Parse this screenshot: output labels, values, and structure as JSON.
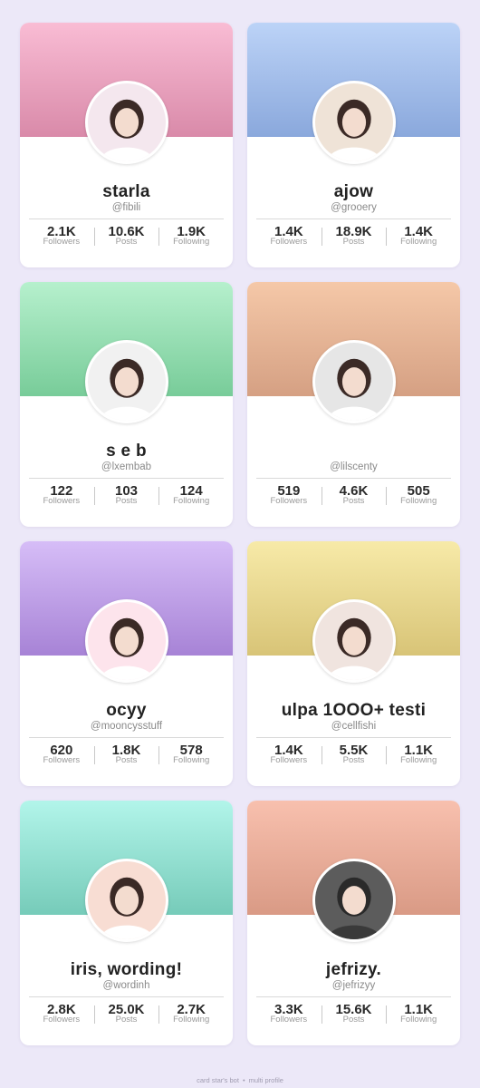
{
  "profiles": [
    {
      "name": "starla",
      "handle": "@fibili",
      "followers": "2.1K",
      "posts": "10.6K",
      "following": "1.9K",
      "banner_top": "#f9bcd4",
      "banner_bottom": "#d98aa9",
      "avatar_bg": "#f4e7ee"
    },
    {
      "name": "ajow",
      "handle": "@grooery",
      "followers": "1.4K",
      "posts": "18.9K",
      "following": "1.4K",
      "banner_top": "#bcd3f7",
      "banner_bottom": "#8aa8dc",
      "avatar_bg": "#efe3d7"
    },
    {
      "name": "s e b",
      "handle": "@lxembab",
      "followers": "122",
      "posts": "103",
      "following": "124",
      "banner_top": "#b6f0cd",
      "banner_bottom": "#78cc99",
      "avatar_bg": "#f1f1f1"
    },
    {
      "name": "",
      "handle": "@lilscenty",
      "followers": "519",
      "posts": "4.6K",
      "following": "505",
      "banner_top": "#f5c8a8",
      "banner_bottom": "#d5a083",
      "avatar_bg": "#e6e6e6"
    },
    {
      "name": "ocyy",
      "handle": "@mooncysstuff",
      "followers": "620",
      "posts": "1.8K",
      "following": "578",
      "banner_top": "#d6bdf7",
      "banner_bottom": "#a783d6",
      "avatar_bg": "#fde4ec"
    },
    {
      "name": "ulpa 1OOO+ testi",
      "handle": "@cellfishi",
      "followers": "1.4K",
      "posts": "5.5K",
      "following": "1.1K",
      "banner_top": "#f7eaa8",
      "banner_bottom": "#d8c477",
      "avatar_bg": "#f0e4df"
    },
    {
      "name": "iris, wording!",
      "handle": "@wordinh",
      "followers": "2.8K",
      "posts": "25.0K",
      "following": "2.7K",
      "banner_top": "#b2f5ea",
      "banner_bottom": "#76cbb9",
      "avatar_bg": "#f8ddd3"
    },
    {
      "name": "jefrizy.",
      "handle": "@jefrizyy",
      "followers": "3.3K",
      "posts": "15.6K",
      "following": "1.1K",
      "banner_top": "#f8c0ae",
      "banner_bottom": "#d99a85",
      "avatar_bg": "#5c5c5c"
    }
  ],
  "labels": {
    "followers": "Followers",
    "posts": "Posts",
    "following": "Following"
  },
  "footer": {
    "left": "card star's bot",
    "right": "multi profile"
  }
}
